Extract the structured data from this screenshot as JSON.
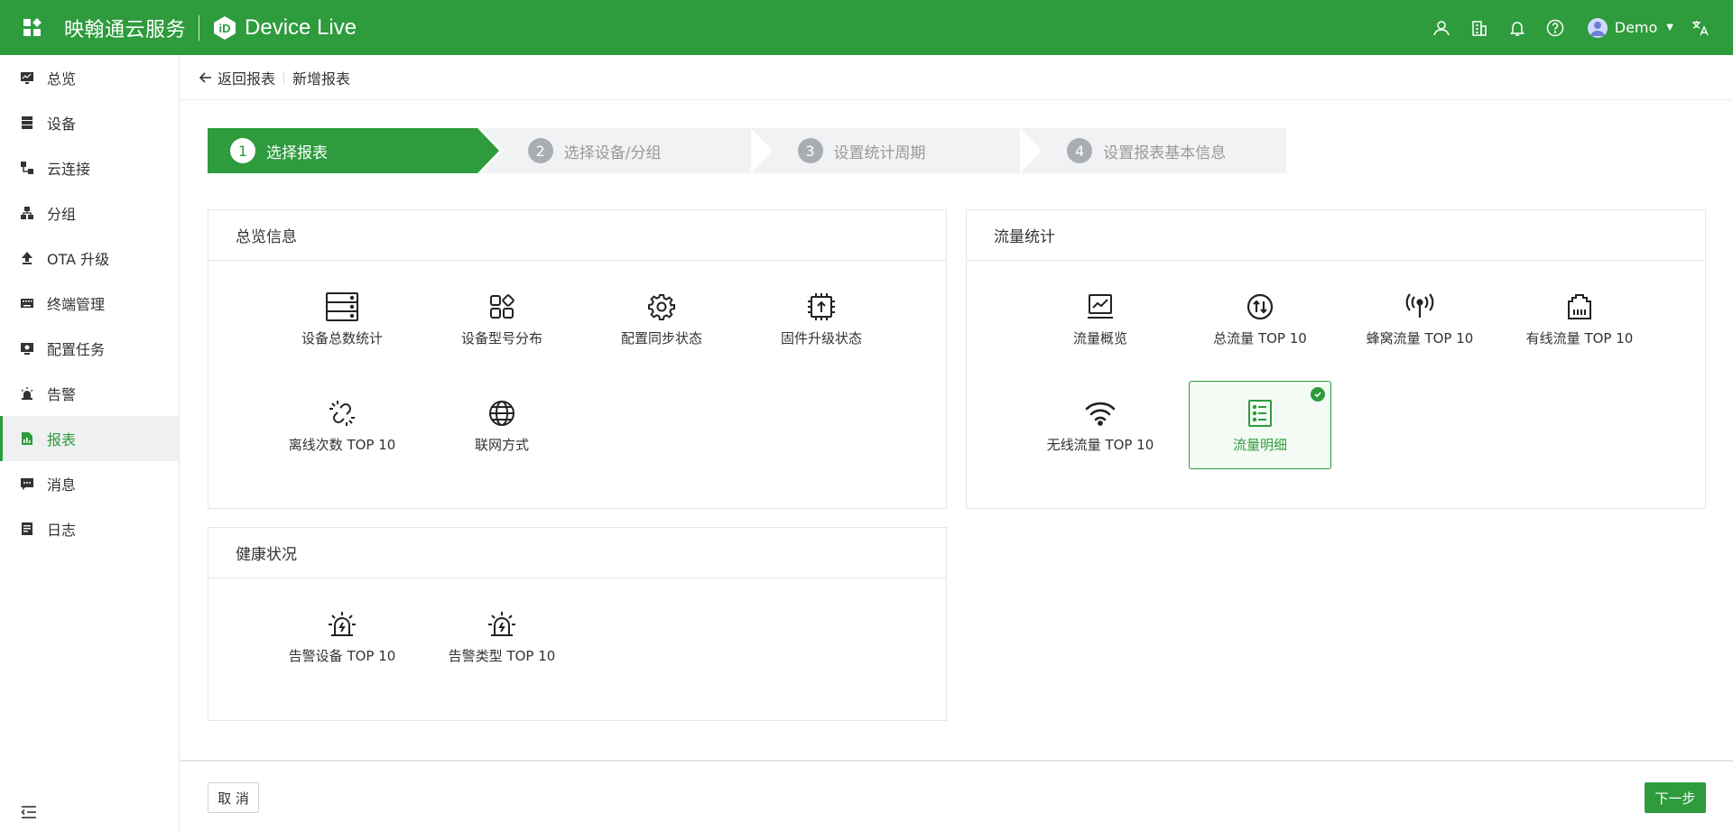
{
  "header": {
    "brand": "映翰通云服务",
    "product": "Device Live",
    "user_name": "Demo"
  },
  "sidebar": {
    "items": [
      {
        "label": "总览",
        "icon": "monitor-icon"
      },
      {
        "label": "设备",
        "icon": "server-icon"
      },
      {
        "label": "云连接",
        "icon": "cloud-connect-icon"
      },
      {
        "label": "分组",
        "icon": "group-icon"
      },
      {
        "label": "OTA 升级",
        "icon": "upload-arrow-icon"
      },
      {
        "label": "终端管理",
        "icon": "keyboard-icon"
      },
      {
        "label": "配置任务",
        "icon": "config-task-icon"
      },
      {
        "label": "告警",
        "icon": "alarm-icon"
      },
      {
        "label": "报表",
        "icon": "report-icon",
        "active": true
      },
      {
        "label": "消息",
        "icon": "message-icon"
      },
      {
        "label": "日志",
        "icon": "log-icon"
      }
    ]
  },
  "breadcrumb": {
    "back_label": "返回报表",
    "current": "新增报表"
  },
  "steps": [
    {
      "num": "1",
      "label": "选择报表",
      "active": true
    },
    {
      "num": "2",
      "label": "选择设备/分组"
    },
    {
      "num": "3",
      "label": "设置统计周期"
    },
    {
      "num": "4",
      "label": "设置报表基本信息"
    }
  ],
  "panels": {
    "overview": {
      "title": "总览信息",
      "tiles": [
        {
          "label": "设备总数统计",
          "icon": "server-stack-icon"
        },
        {
          "label": "设备型号分布",
          "icon": "model-grid-icon"
        },
        {
          "label": "配置同步状态",
          "icon": "gear-icon"
        },
        {
          "label": "固件升级状态",
          "icon": "chip-upload-icon"
        },
        {
          "label": "离线次数 TOP 10",
          "icon": "broken-link-icon"
        },
        {
          "label": "联网方式",
          "icon": "globe-icon"
        }
      ]
    },
    "traffic": {
      "title": "流量统计",
      "tiles": [
        {
          "label": "流量概览",
          "icon": "chart-monitor-icon"
        },
        {
          "label": "总流量 TOP 10",
          "icon": "up-down-circle-icon"
        },
        {
          "label": "蜂窝流量 TOP 10",
          "icon": "antenna-icon"
        },
        {
          "label": "有线流量 TOP 10",
          "icon": "ethernet-port-icon"
        },
        {
          "label": "无线流量 TOP 10",
          "icon": "wifi-icon"
        },
        {
          "label": "流量明细",
          "icon": "list-detail-icon",
          "selected": true
        }
      ]
    },
    "health": {
      "title": "健康状况",
      "tiles": [
        {
          "label": "告警设备 TOP 10",
          "icon": "siren-icon"
        },
        {
          "label": "告警类型 TOP 10",
          "icon": "siren-icon"
        }
      ]
    }
  },
  "footer": {
    "cancel_label": "取 消",
    "next_label": "下一步"
  },
  "colors": {
    "primary": "#2e9b3d",
    "step_inactive_bg": "#f0f2f4"
  }
}
